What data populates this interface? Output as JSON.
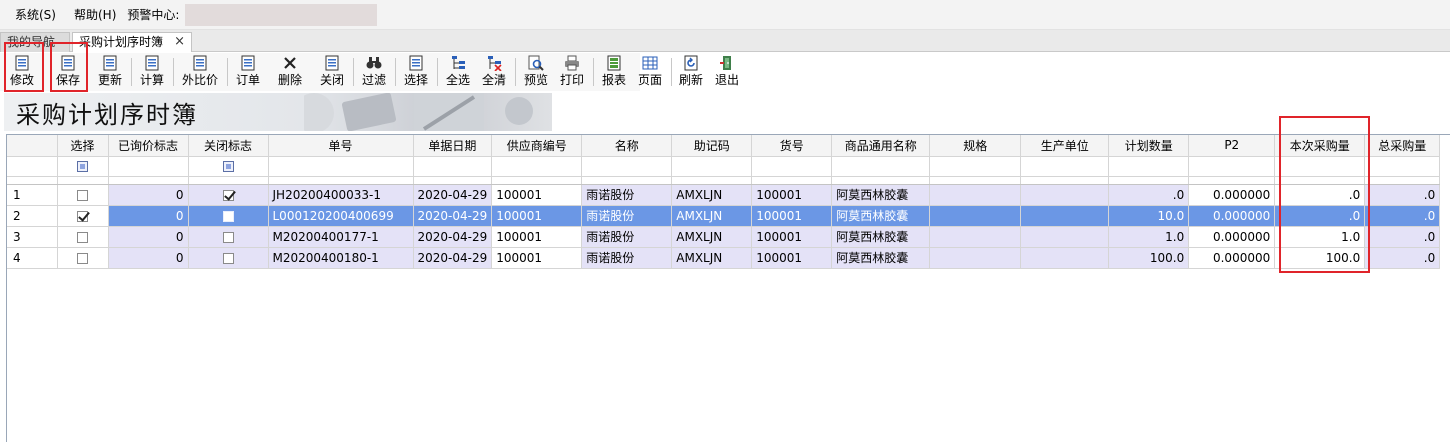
{
  "menubar": {
    "items": [
      "系统(S)",
      "帮助(H)"
    ],
    "alert_label": "预警中心:"
  },
  "tabs": {
    "inactive": "我的导航",
    "active": "采购计划序时簿",
    "close": "×"
  },
  "toolbar": {
    "buttons": [
      "修改",
      "保存",
      "更新",
      "计算",
      "外比价",
      "订单",
      "删除",
      "关闭",
      "过滤",
      "选择",
      "全选",
      "全清",
      "预览",
      "打印",
      "报表",
      "页面",
      "刷新",
      "退出"
    ]
  },
  "banner": {
    "title": "采购计划序时簿"
  },
  "grid": {
    "headers": [
      "",
      "选择",
      "已询价标志",
      "关闭标志",
      "单号",
      "单据日期",
      "供应商编号",
      "名称",
      "助记码",
      "货号",
      "商品通用名称",
      "规格",
      "生产单位",
      "计划数量",
      "P2",
      "本次采购量",
      "总采购量"
    ],
    "rows": [
      {
        "idx": "1",
        "select": false,
        "inquired": "0",
        "closed": true,
        "no": "JH20200400033-1",
        "date": "2020-04-29",
        "supplier": "100001",
        "name": "雨诺股份",
        "code": "AMXLJN",
        "sku": "100001",
        "generic": "阿莫西林胶囊",
        "spec": "",
        "maker": "",
        "plan": ".0",
        "p2": "0.000000",
        "current": ".0",
        "total": ".0"
      },
      {
        "idx": "2",
        "select": true,
        "inquired": "0",
        "closed": false,
        "no": "L000120200400699",
        "date": "2020-04-29",
        "supplier": "100001",
        "name": "雨诺股份",
        "code": "AMXLJN",
        "sku": "100001",
        "generic": "阿莫西林胶囊",
        "spec": "",
        "maker": "",
        "plan": "10.0",
        "p2": "0.000000",
        "current": ".0",
        "total": ".0"
      },
      {
        "idx": "3",
        "select": false,
        "inquired": "0",
        "closed": false,
        "no": "M20200400177-1",
        "date": "2020-04-29",
        "supplier": "100001",
        "name": "雨诺股份",
        "code": "AMXLJN",
        "sku": "100001",
        "generic": "阿莫西林胶囊",
        "spec": "",
        "maker": "",
        "plan": "1.0",
        "p2": "0.000000",
        "current": "1.0",
        "total": ".0"
      },
      {
        "idx": "4",
        "select": false,
        "inquired": "0",
        "closed": false,
        "no": "M20200400180-1",
        "date": "2020-04-29",
        "supplier": "100001",
        "name": "雨诺股份",
        "code": "AMXLJN",
        "sku": "100001",
        "generic": "阿莫西林胶囊",
        "spec": "",
        "maker": "",
        "plan": "100.0",
        "p2": "0.000000",
        "current": "100.0",
        "total": ".0"
      }
    ]
  },
  "colors": {
    "highlight": "#e0242a",
    "selected_row": "#6b97e5",
    "lavender_cell": "#e4e2f7"
  }
}
